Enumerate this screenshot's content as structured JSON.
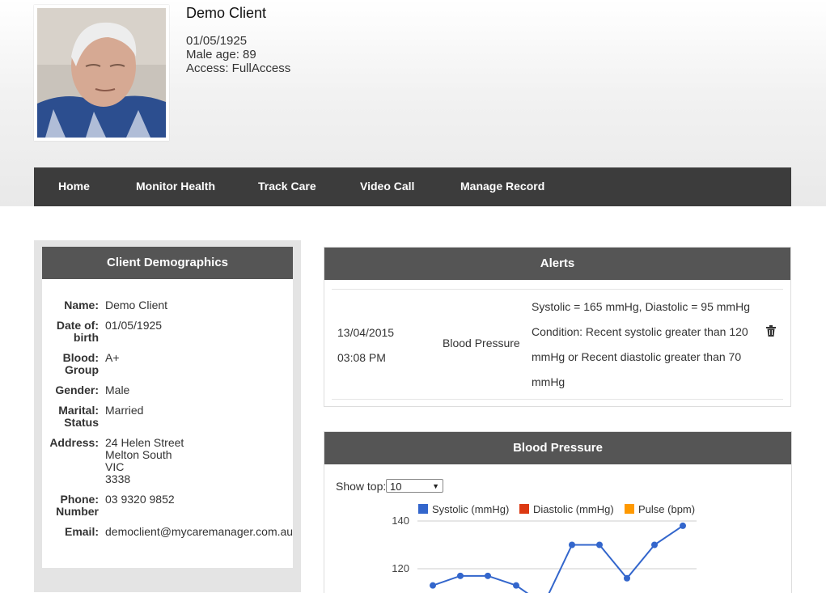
{
  "client": {
    "name": "Demo Client",
    "dob": "01/05/1925",
    "age_line": "Male age: 89",
    "access_line": "Access: FullAccess"
  },
  "nav": {
    "home": "Home",
    "monitor": "Monitor Health",
    "track": "Track Care",
    "video": "Video Call",
    "manage": "Manage Record"
  },
  "demographics": {
    "title": "Client Demographics",
    "name_label": "Name:",
    "name_value": "Demo Client",
    "dob_label_1": "Date of:",
    "dob_label_2": "birth",
    "dob_value": "01/05/1925",
    "blood_label_1": "Blood:",
    "blood_label_2": "Group",
    "blood_value": "A+",
    "gender_label": "Gender:",
    "gender_value": "Male",
    "marital_label_1": "Marital:",
    "marital_label_2": "Status",
    "marital_value": "Married",
    "address_label": "Address:",
    "address_line1": "24 Helen Street",
    "address_line2": "Melton South",
    "address_line3": "VIC",
    "address_line4": "3338",
    "phone_label_1": "Phone:",
    "phone_label_2": "Number",
    "phone_value": "03 9320 9852",
    "email_label": "Email:",
    "email_value": "democlient@mycaremanager.com.au"
  },
  "alerts": {
    "title": "Alerts",
    "items": [
      {
        "date": "13/04/2015",
        "time": "03:08 PM",
        "type": "Blood Pressure",
        "line1": "Systolic = 165 mmHg, Diastolic = 95 mmHg",
        "line2": "Condition: Recent systolic greater than 120",
        "line3": "mmHg or Recent diastolic greater than 70",
        "line4": "mmHg"
      }
    ]
  },
  "blood_pressure": {
    "title": "Blood Pressure",
    "show_top_label": "Show top:",
    "show_top_value": "10"
  },
  "chart_data": {
    "type": "line",
    "series": [
      {
        "name": "Systolic (mmHg)",
        "color": "#3366cc",
        "values": [
          113,
          117,
          117,
          113,
          105,
          130,
          130,
          116,
          130,
          138
        ]
      },
      {
        "name": "Diastolic (mmHg)",
        "color": "#dc3912",
        "values": []
      },
      {
        "name": "Pulse (bpm)",
        "color": "#ff9900",
        "values": []
      }
    ],
    "y_ticks": [
      140,
      120
    ],
    "grid": true,
    "legend": "top"
  }
}
